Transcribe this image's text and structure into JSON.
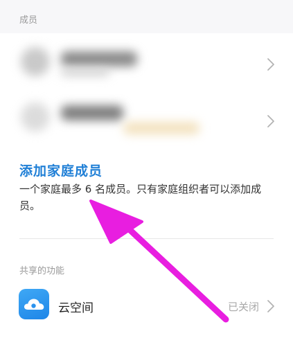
{
  "members_section": {
    "label": "成员"
  },
  "add_member": {
    "title": "添加家庭成员",
    "description": "一个家庭最多 6 名成员。只有家庭组织者可以添加成员。"
  },
  "shared_section": {
    "label": "共享的功能",
    "items": [
      {
        "name": "云空间",
        "status": "已关闭",
        "icon": "cloud-icon"
      }
    ]
  },
  "colors": {
    "accent": "#1f7fd6",
    "annotation_arrow": "#e81ee0"
  }
}
